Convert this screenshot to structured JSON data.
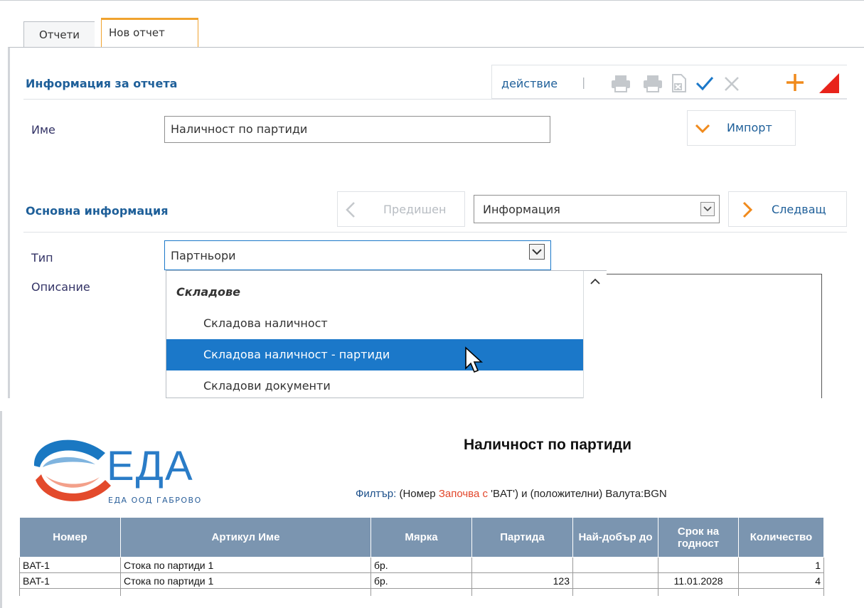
{
  "tabs": [
    {
      "label": "Отчети",
      "active": false
    },
    {
      "label": "Нов отчет",
      "active": true
    }
  ],
  "report_info": {
    "title": "Информация за отчета",
    "action_label": "действие",
    "toolbar_icons": [
      "print-icon",
      "print-icon",
      "excel-export-icon",
      "check-icon",
      "close-icon",
      "plus-icon",
      "corner-flag-icon"
    ],
    "name_label": "Име",
    "name_value": "Наличност по партиди",
    "import_label": "Импорт"
  },
  "basic_info": {
    "title": "Основна информация",
    "prev_label": "Предишен",
    "section_select": "Информация",
    "next_label": "Следващ",
    "type_label": "Тип",
    "type_value": "Партньори",
    "description_label": "Описание",
    "dropdown": {
      "group": "Складове",
      "options": [
        "Складова наличност",
        "Складова наличност - партиди",
        "Складови документи"
      ],
      "selected_index": 1
    }
  },
  "report": {
    "logo_text": "ЕДА",
    "logo_subtitle": "ЕДА ООД ГАБРОВО",
    "title": "Наличност по партиди",
    "filter": {
      "prefix": "Филтър:",
      "part1": "(Номер",
      "operator": "Започва с",
      "part2": "'BAT') и (положителни) Валута:BGN"
    },
    "columns": [
      "Номер",
      "Артикул Име",
      "Мярка",
      "Партида",
      "Най-добър до",
      "Срок на годност",
      "Количество"
    ],
    "rows": [
      [
        "BAT-1",
        "Стока по партиди 1",
        "бр.",
        "",
        "",
        "",
        "1"
      ],
      [
        "BAT-1",
        "Стока по партиди 1",
        "бр.",
        "123",
        "",
        "11.01.2028",
        "4"
      ]
    ]
  },
  "colors": {
    "accent_orange": "#f0a32f",
    "title_blue": "#1e5f99",
    "selected_blue": "#1b78c9",
    "header_gray_blue": "#7b95b0",
    "filter_red": "#e2462b"
  }
}
